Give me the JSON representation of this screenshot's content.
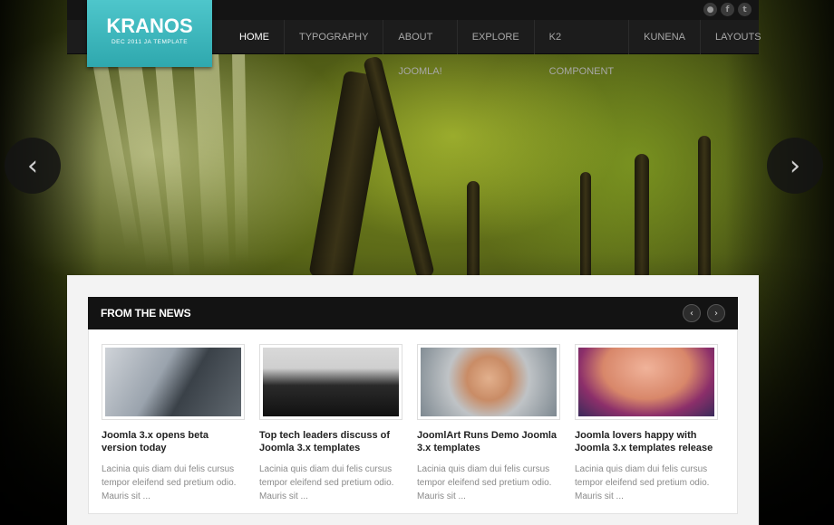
{
  "header": {
    "logo_name": "KRANOS",
    "logo_tagline": "DEC 2011 JA TEMPLATE",
    "social": [
      {
        "icon": "rss-icon",
        "glyph": "●"
      },
      {
        "icon": "facebook-icon",
        "glyph": "f"
      },
      {
        "icon": "twitter-icon",
        "glyph": "t"
      }
    ],
    "nav": [
      {
        "label": "HOME",
        "active": true
      },
      {
        "label": "TYPOGRAPHY",
        "active": false
      },
      {
        "label": "ABOUT JOOMLA!",
        "active": false
      },
      {
        "label": "EXPLORE",
        "active": false
      },
      {
        "label": "K2 COMPONENT",
        "active": false
      },
      {
        "label": "KUNENA",
        "active": false
      },
      {
        "label": "LAYOUTS",
        "active": false
      }
    ]
  },
  "slider": {
    "prev_glyph": "‹",
    "next_glyph": "›"
  },
  "news": {
    "title": "FROM THE NEWS",
    "prev_glyph": "‹",
    "next_glyph": "›",
    "items": [
      {
        "title": "Joomla 3.x opens beta version today",
        "excerpt": "Lacinia quis diam dui felis cursus tempor eleifend sed pretium odio. Mauris sit ..."
      },
      {
        "title": "Top tech leaders discuss of Joomla 3.x templates",
        "excerpt": "Lacinia quis diam dui felis cursus tempor eleifend sed pretium odio. Mauris sit ..."
      },
      {
        "title": "JoomlArt Runs Demo Joomla 3.x templates",
        "excerpt": "Lacinia quis diam dui felis cursus tempor eleifend sed pretium odio. Mauris sit ..."
      },
      {
        "title": "Joomla lovers happy with Joomla 3.x templates release",
        "excerpt": "Lacinia quis diam dui felis cursus tempor eleifend sed pretium odio. Mauris sit ..."
      }
    ]
  },
  "colors": {
    "logo_bg": "#3bb8be",
    "nav_bg": "#1c1c1c",
    "panel_bg": "#f3f3f3",
    "news_bar_bg": "#131313"
  }
}
